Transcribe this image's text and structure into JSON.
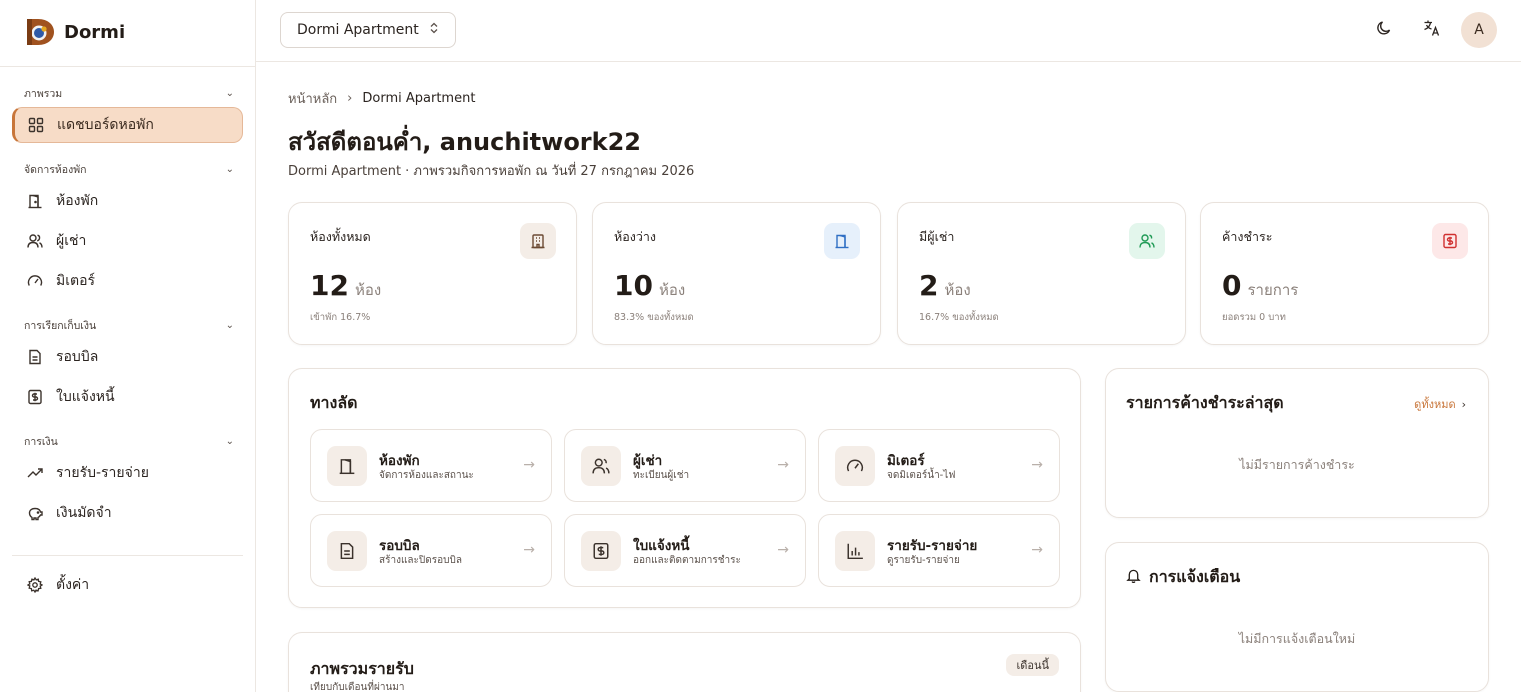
{
  "brand": {
    "name": "Dormi"
  },
  "sidebar": {
    "sections": [
      {
        "label": "ภาพรวม"
      },
      {
        "label": "จัดการห้องพัก"
      },
      {
        "label": "การเรียกเก็บเงิน"
      },
      {
        "label": "การเงิน"
      }
    ],
    "items": [
      {
        "label": "แดชบอร์ดหอพัก",
        "icon": "dashboard-grid-icon",
        "active": true
      },
      {
        "label": "ห้องพัก",
        "icon": "door-icon"
      },
      {
        "label": "ผู้เช่า",
        "icon": "users-icon"
      },
      {
        "label": "มิเตอร์",
        "icon": "gauge-icon"
      },
      {
        "label": "รอบบิล",
        "icon": "document-icon"
      },
      {
        "label": "ใบแจ้งหนี้",
        "icon": "invoice-icon"
      },
      {
        "label": "รายรับ-รายจ่าย",
        "icon": "trend-up-icon"
      },
      {
        "label": "เงินมัดจำ",
        "icon": "piggy-bank-icon"
      },
      {
        "label": "ตั้งค่า",
        "icon": "gear-icon"
      }
    ]
  },
  "topbar": {
    "property_select": "Dormi Apartment",
    "avatar_initial": "A"
  },
  "breadcrumb": {
    "home": "หน้าหลัก",
    "current": "Dormi Apartment"
  },
  "greeting": "สวัสดีตอนค่ำ, anuchitwork22",
  "subtitle": "Dormi Apartment · ภาพรวมกิจการหอพัก ณ วันที่ 27 กรกฎาคม 2026",
  "stats": [
    {
      "label": "ห้องทั้งหมด",
      "value": "12",
      "unit": "ห้อง",
      "note": "เข้าพัก 16.7%",
      "icon": "building-icon",
      "color": "#f4ede7",
      "icon_color": "#6b4a33"
    },
    {
      "label": "ห้องว่าง",
      "value": "10",
      "unit": "ห้อง",
      "note": "83.3% ของทั้งหมด",
      "icon": "door-icon",
      "color": "#e6f0fb",
      "icon_color": "#2f6fc4"
    },
    {
      "label": "มีผู้เช่า",
      "value": "2",
      "unit": "ห้อง",
      "note": "16.7% ของทั้งหมด",
      "icon": "users-icon",
      "color": "#e3f6ec",
      "icon_color": "#1f9a55"
    },
    {
      "label": "ค้างชำระ",
      "value": "0",
      "unit": "รายการ",
      "note": "ยอดรวม 0 บาท",
      "icon": "invoice-icon",
      "color": "#fde8e8",
      "icon_color": "#d03030"
    }
  ],
  "shortcuts": {
    "title": "ทางลัด",
    "items": [
      {
        "title": "ห้องพัก",
        "desc": "จัดการห้องและสถานะ",
        "icon": "door-icon"
      },
      {
        "title": "ผู้เช่า",
        "desc": "ทะเบียนผู้เช่า",
        "icon": "users-icon"
      },
      {
        "title": "มิเตอร์",
        "desc": "จดมิเตอร์น้ำ-ไฟ",
        "icon": "gauge-icon"
      },
      {
        "title": "รอบบิล",
        "desc": "สร้างและปิดรอบบิล",
        "icon": "document-icon"
      },
      {
        "title": "ใบแจ้งหนี้",
        "desc": "ออกและติดตามการชำระ",
        "icon": "invoice-icon"
      },
      {
        "title": "รายรับ-รายจ่าย",
        "desc": "ดูรายรับ-รายจ่าย",
        "icon": "bar-chart-icon"
      }
    ]
  },
  "overdue": {
    "title": "รายการค้างชำระล่าสุด",
    "view_all": "ดูทั้งหมด",
    "empty": "ไม่มีรายการค้างชำระ"
  },
  "notifications": {
    "title": "การแจ้งเตือน",
    "empty": "ไม่มีการแจ้งเตือนใหม่"
  },
  "income": {
    "title": "ภาพรวมรายรับ",
    "subtitle": "เทียบกับเดือนที่ผ่านมา",
    "period": "เดือนนี้"
  }
}
